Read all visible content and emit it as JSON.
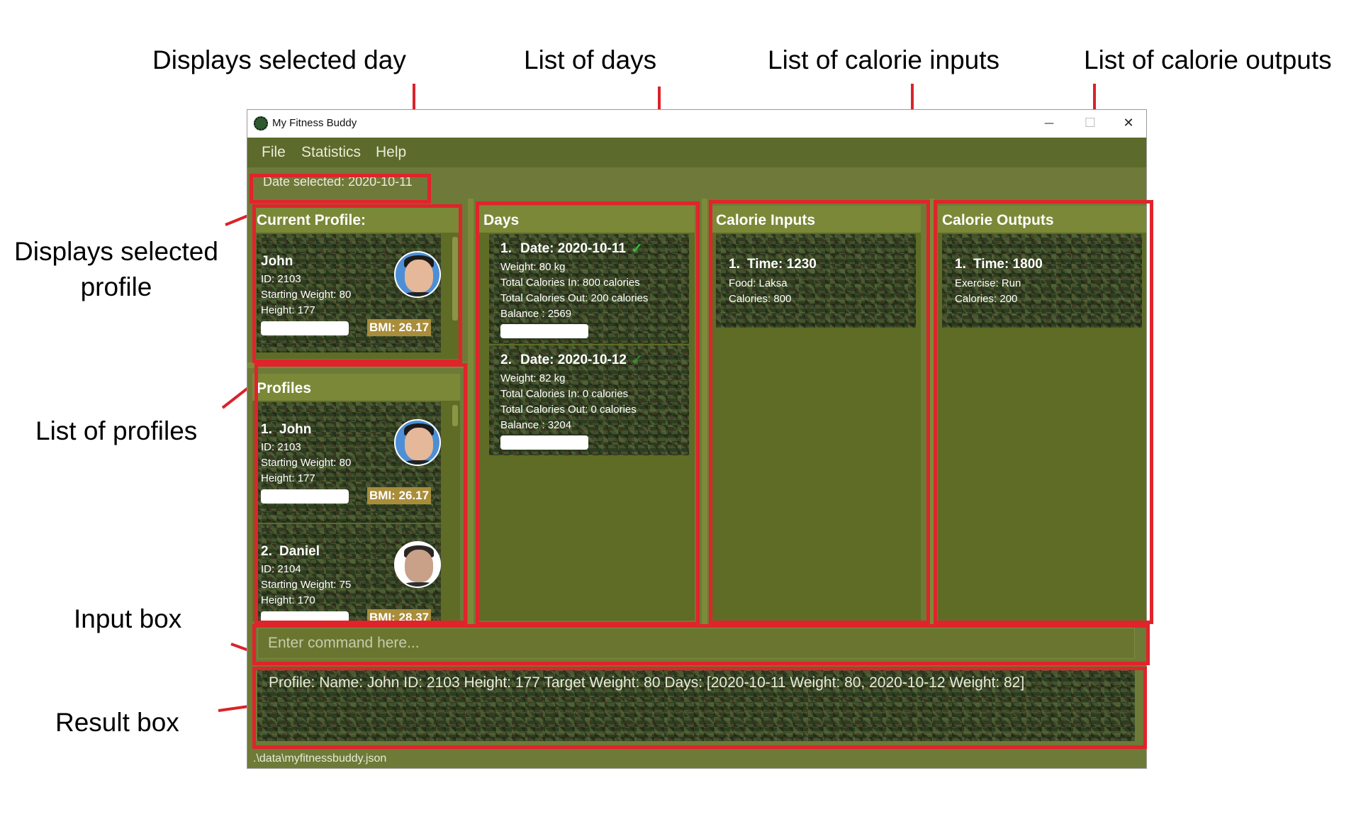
{
  "annotations": {
    "selected_day": "Displays selected day",
    "list_days": "List of days",
    "calorie_inputs": "List of calorie inputs",
    "calorie_outputs": "List of calorie outputs",
    "selected_profile_line1": "Displays selected",
    "selected_profile_line2": "profile",
    "list_profiles": "List of profiles",
    "input_box": "Input box",
    "result_box": "Result box"
  },
  "window": {
    "title": "My Fitness Buddy",
    "minimize": "—",
    "maximize": "☐",
    "close": "✕"
  },
  "menu": [
    "File",
    "Statistics",
    "Help"
  ],
  "date_selected": "Date selected: 2020-10-11",
  "current_profile": {
    "heading": "Current Profile:",
    "name": "John",
    "id": "ID: 2103",
    "starting_weight": "Starting Weight: 80",
    "height": "Height: 177",
    "bmi": "BMI: 26.17"
  },
  "profiles": {
    "heading": "Profiles",
    "items": [
      {
        "index": "1.",
        "name": "John",
        "id": "ID: 2103",
        "starting_weight": "Starting Weight: 80",
        "height": "Height: 177",
        "bmi": "BMI: 26.17"
      },
      {
        "index": "2.",
        "name": "Daniel",
        "id": "ID: 2104",
        "starting_weight": "Starting Weight: 75",
        "height": "Height: 170",
        "bmi": "BMI: 28.37"
      }
    ]
  },
  "days": {
    "heading": "Days",
    "items": [
      {
        "index": "1.",
        "date": "Date: 2020-10-11",
        "weight": "Weight: 80 kg",
        "cal_in": "Total Calories In: 800 calories",
        "cal_out": "Total Calories Out: 200 calories",
        "balance": "Balance : 2569",
        "check": "✓"
      },
      {
        "index": "2.",
        "date": "Date: 2020-10-12",
        "weight": "Weight: 82 kg",
        "cal_in": "Total Calories In: 0 calories",
        "cal_out": "Total Calories Out: 0 calories",
        "balance": "Balance : 3204",
        "check": "✓"
      }
    ]
  },
  "calorie_inputs": {
    "heading": "Calorie Inputs",
    "items": [
      {
        "index": "1.",
        "time": "Time: 1230",
        "food": "Food: Laksa",
        "calories": "Calories: 800"
      }
    ]
  },
  "calorie_outputs": {
    "heading": "Calorie Outputs",
    "items": [
      {
        "index": "1.",
        "time": "Time: 1800",
        "exercise": "Exercise: Run",
        "calories": "Calories: 200"
      }
    ]
  },
  "command": {
    "placeholder": "Enter command here..."
  },
  "result": "Profile:  Name: John ID: 2103 Height: 177 Target Weight: 80 Days: [2020-10-11 Weight: 80, 2020-10-12 Weight: 82]",
  "status_path": ".\\data\\myfitnessbuddy.json",
  "colors": {
    "window_bg": "#6e7a37",
    "menubar": "#5c6a2b",
    "panel_head": "#7b8838",
    "annotation_red": "#e0242b",
    "bmi_badge": "#a98d3a",
    "check_green": "#2fbf3a"
  }
}
